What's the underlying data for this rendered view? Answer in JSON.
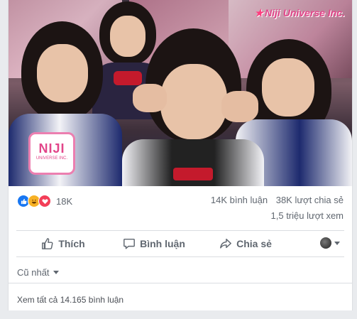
{
  "video": {
    "brand_text": "Niji Universe Inc.",
    "logo_title": "NIJI",
    "logo_subtitle": "UNIVERSE INC."
  },
  "reactions": {
    "icons": [
      "like-icon",
      "haha-icon",
      "love-icon"
    ],
    "count": "18K"
  },
  "counts": {
    "comments": "14K bình luận",
    "shares": "38K lượt chia sẻ",
    "views": "1,5 triệu lượt xem"
  },
  "actions": {
    "like": "Thích",
    "comment": "Bình luận",
    "share": "Chia sẻ"
  },
  "comments": {
    "sort_label": "Cũ nhất",
    "view_all": "Xem tất cả 14.165 bình luận"
  },
  "colors": {
    "like": "#1877f2",
    "haha": "#f7b125",
    "love": "#f33e58",
    "brand": "#e2468a"
  }
}
